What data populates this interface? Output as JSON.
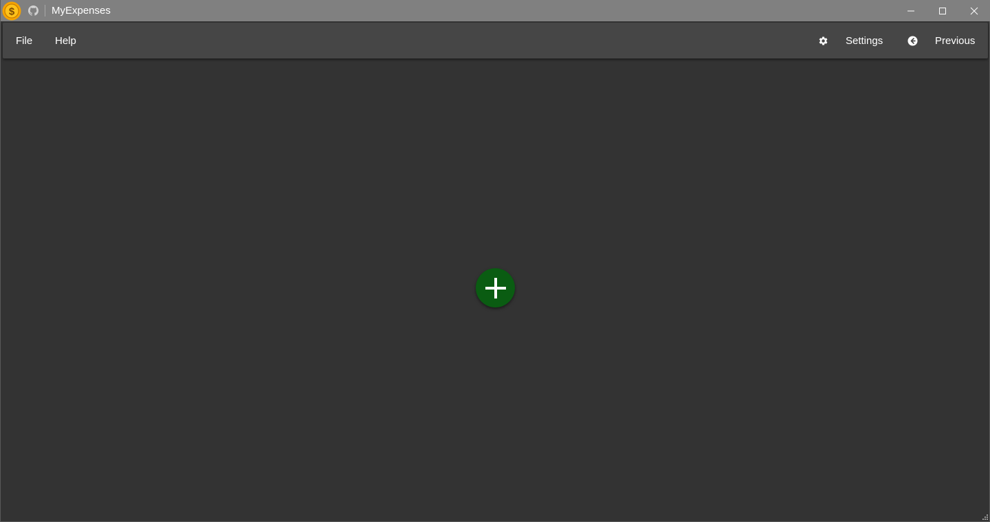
{
  "titlebar": {
    "title": "MyExpenses",
    "logo_icon": "dollar-coin-icon",
    "github_icon": "github-icon",
    "controls": [
      "minimize-icon",
      "maximize-icon",
      "close-icon"
    ]
  },
  "menu": {
    "file_label": "File",
    "help_label": "Help"
  },
  "toolbar": {
    "settings_label": "Settings",
    "settings_icon": "gear-icon",
    "previous_label": "Previous",
    "previous_icon": "arrow-left-circle-icon"
  },
  "main": {
    "add_icon": "plus-icon",
    "add_button_color": "#0a5c12"
  },
  "colors": {
    "titlebar": "#808080",
    "toolbar": "#464646",
    "background": "#333333",
    "logo_orange": "#f5a300"
  }
}
